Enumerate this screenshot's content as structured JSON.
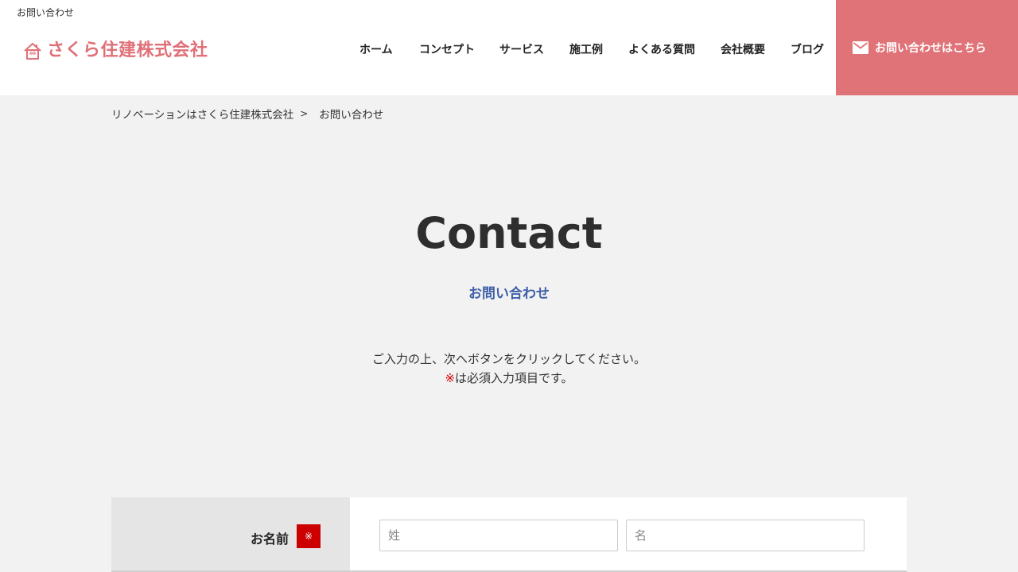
{
  "header": {
    "top_note": "お問い合わせ",
    "logo_text": "さくら住建株式会社",
    "nav": [
      "ホーム",
      "コンセプト",
      "サービス",
      "施工例",
      "よくある質問",
      "会社概要",
      "ブログ"
    ],
    "cta_label": "お問い合わせはこちら"
  },
  "breadcrumb": {
    "home": "リノベーションはさくら住建株式会社",
    "separator": ">",
    "current": "お問い合わせ"
  },
  "hero": {
    "title": "Contact",
    "subtitle": "お問い合わせ"
  },
  "intro": {
    "line1": "ご入力の上、次へボタンをクリックしてください。",
    "mark": "※",
    "line2": "は必須入力項目です。"
  },
  "form": {
    "name_label": "お名前",
    "required_badge": "※",
    "last_name_placeholder": "姓",
    "first_name_placeholder": "名"
  },
  "colors": {
    "brand": "#e07378",
    "subtitle": "#3f5fa8",
    "required": "#cc0000"
  }
}
